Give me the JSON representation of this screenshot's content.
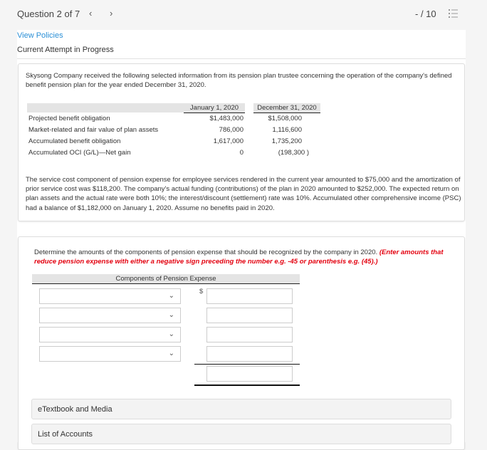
{
  "header": {
    "question_label": "Question 2 of 7",
    "prev_glyph": "‹",
    "next_glyph": "›",
    "score": "- / 10",
    "list_icon": "list-icon"
  },
  "links": {
    "view_policies": "View Policies"
  },
  "status": {
    "attempt": "Current Attempt in Progress"
  },
  "problem": {
    "intro": "Skysong Company received the following selected information from its pension plan trustee concerning the operation of the company's defined benefit pension plan for the year ended December 31, 2020.",
    "table": {
      "headers": [
        "",
        "January 1, 2020",
        "December 31, 2020"
      ],
      "rows": [
        [
          "Projected benefit obligation",
          "$1,483,000",
          "$1,508,000"
        ],
        [
          "Market-related and fair value of plan assets",
          "786,000",
          "1,116,600"
        ],
        [
          "Accumulated benefit obligation",
          "1,617,000",
          "1,735,200"
        ],
        [
          "Accumulated OCI (G/L)—Net gain",
          "0",
          "(198,300 )"
        ]
      ]
    },
    "details": "The service cost component of pension expense for employee services rendered in the current year amounted to $75,000 and the amortization of prior service cost was $118,200. The company's actual funding (contributions) of the plan in 2020 amounted to $252,000. The expected return on plan assets and the actual rate were both 10%; the interest/discount (settlement) rate was 10%. Accumulated other comprehensive income (PSC) had a balance of $1,182,000 on January 1, 2020. Assume no benefits paid in 2020."
  },
  "question": {
    "prompt": "Determine the amounts of the components of pension expense that should be recognized by the company in 2020.",
    "instruction": "(Enter amounts that reduce pension expense with either a negative sign preceding the number e.g. -45 or parenthesis e.g. (45).)",
    "table_header": "Components of Pension Expense",
    "currency_symbol": "$",
    "rows": [
      {
        "select_value": "",
        "amount": ""
      },
      {
        "select_value": "",
        "amount": ""
      },
      {
        "select_value": "",
        "amount": ""
      },
      {
        "select_value": "",
        "amount": ""
      }
    ],
    "total": ""
  },
  "resources": {
    "etextbook": "eTextbook and Media",
    "accounts": "List of Accounts"
  }
}
